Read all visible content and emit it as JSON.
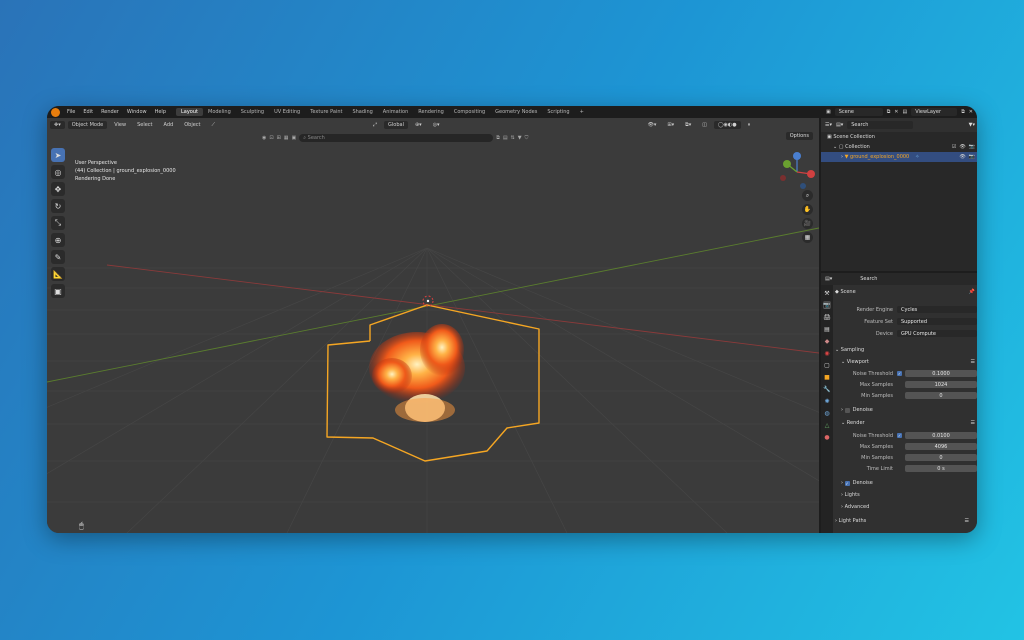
{
  "menus": [
    "File",
    "Edit",
    "Render",
    "Window",
    "Help"
  ],
  "workspaces": [
    "Layout",
    "Modeling",
    "Sculpting",
    "UV Editing",
    "Texture Paint",
    "Shading",
    "Animation",
    "Rendering",
    "Compositing",
    "Geometry Nodes",
    "Scripting"
  ],
  "active_workspace": "Layout",
  "add_workspace": "+",
  "scene_name": "Scene",
  "view_layer": "ViewLayer",
  "viewport": {
    "mode": "Object Mode",
    "menus": [
      "View",
      "Select",
      "Add",
      "Object"
    ],
    "transform_orientation": "Global",
    "search_placeholder": "Search",
    "options_label": "Options",
    "overlay_lines": [
      "User Perspective",
      "(44) Collection | ground_explosion_0000",
      "Rendering Done"
    ]
  },
  "outliner": {
    "search_placeholder": "Search",
    "rows": [
      {
        "label": "Scene Collection",
        "level": 0
      },
      {
        "label": "Collection",
        "level": 1
      },
      {
        "label": "ground_explosion_0000",
        "level": 2,
        "selected": true
      }
    ]
  },
  "properties": {
    "search_placeholder": "Search",
    "context": "Scene",
    "render_engine_label": "Render Engine",
    "render_engine": "Cycles",
    "feature_set_label": "Feature Set",
    "feature_set": "Supported",
    "device_label": "Device",
    "device": "GPU Compute",
    "sampling_label": "Sampling",
    "viewport_label": "Viewport",
    "vp_noise_label": "Noise Threshold",
    "vp_noise": "0.1000",
    "vp_max_label": "Max Samples",
    "vp_max": "1024",
    "vp_min_label": "Min Samples",
    "vp_min": "0",
    "vp_denoise_label": "Denoise",
    "render_label": "Render",
    "r_noise_label": "Noise Threshold",
    "r_noise": "0.0100",
    "r_max_label": "Max Samples",
    "r_max": "4096",
    "r_min_label": "Min Samples",
    "r_min": "0",
    "r_time_label": "Time Limit",
    "r_time": "0 s",
    "r_denoise_label": "Denoise",
    "lights_label": "Lights",
    "advanced_label": "Advanced",
    "light_paths_label": "Light Paths"
  },
  "colors": {
    "accent": "#4772b3",
    "brand": "#e87d0d",
    "selection": "#f5a623"
  }
}
